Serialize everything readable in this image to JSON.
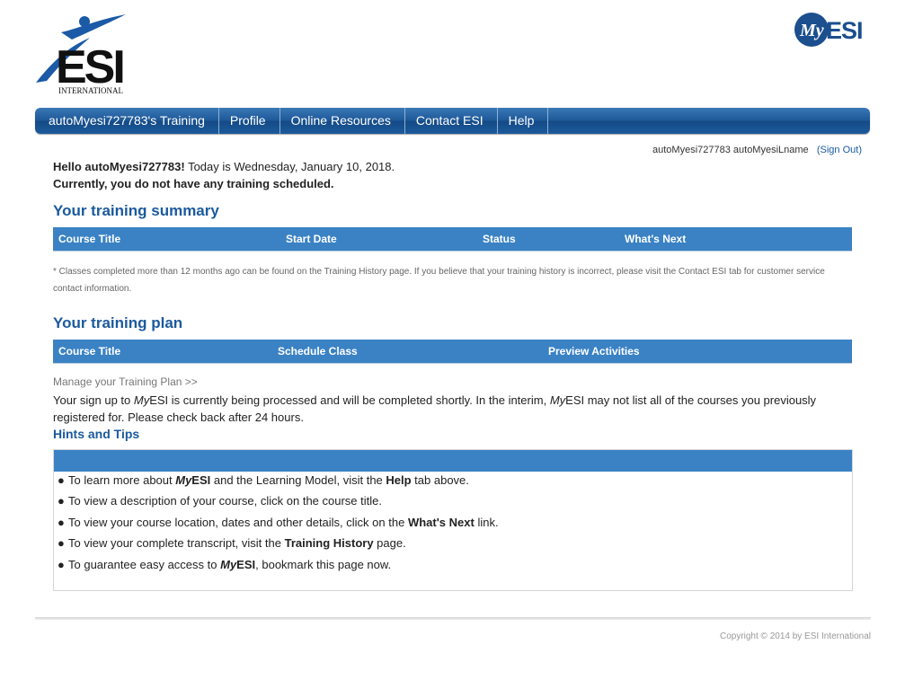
{
  "logos": {
    "esi_text": "ESI",
    "esi_subtext": "INTERNATIONAL",
    "myesi_my": "My",
    "myesi_esi": "ESI"
  },
  "colors": {
    "nav_blue": "#1d5797",
    "table_header_blue": "#3a82c4",
    "heading_blue": "#1b5a9e"
  },
  "nav": {
    "items": [
      "autoMyesi727783's Training",
      "Profile",
      "Online Resources",
      "Contact ESI",
      "Help"
    ]
  },
  "user": {
    "name": "autoMyesi727783 autoMyesiLname",
    "signout": "(Sign Out)"
  },
  "greeting": {
    "hello": "Hello autoMyesi727783!",
    "today": " Today is Wednesday, January 10, 2018.",
    "no_training": "Currently, you do not have any training scheduled."
  },
  "summary": {
    "title": "Your training summary",
    "columns": [
      "Course Title",
      "Start Date",
      "Status",
      "What's Next"
    ],
    "note": "* Classes completed more than 12 months ago can be found on the Training History page. If you believe that your training history is incorrect, please visit the Contact ESI tab for customer service contact information."
  },
  "plan": {
    "title": "Your training plan",
    "columns": [
      "Course Title",
      "Schedule Class",
      "Preview Activities"
    ],
    "manage_link": "Manage your Training Plan >>",
    "signup_text_1": "Your sign up to ",
    "signup_my_1": "My",
    "signup_text_2": "ESI is currently being processed and will be completed shortly. In the interim, ",
    "signup_my_2": "My",
    "signup_text_3": "ESI may not list all of the courses you previously registered for. Please check back after 24 hours."
  },
  "hints": {
    "title": "Hints and Tips",
    "items": [
      {
        "pre": "To learn more about ",
        "my": "My",
        "bold": "ESI",
        "mid": " and the Learning Model, visit the ",
        "bold2": "Help",
        "post": " tab above."
      },
      {
        "pre": "To view a description of your course, click on the course title."
      },
      {
        "pre": "To view your course location, dates and other details, click on the ",
        "bold": "What's Next",
        "post": " link."
      },
      {
        "pre": "To view your complete transcript, visit the ",
        "bold": "Training History",
        "post": " page."
      },
      {
        "pre": "To guarantee easy access to ",
        "my": "My",
        "bold": "ESI",
        "post": ", bookmark this page now."
      }
    ]
  },
  "footer": {
    "copyright": "Copyright © 2014 by ESI International"
  }
}
